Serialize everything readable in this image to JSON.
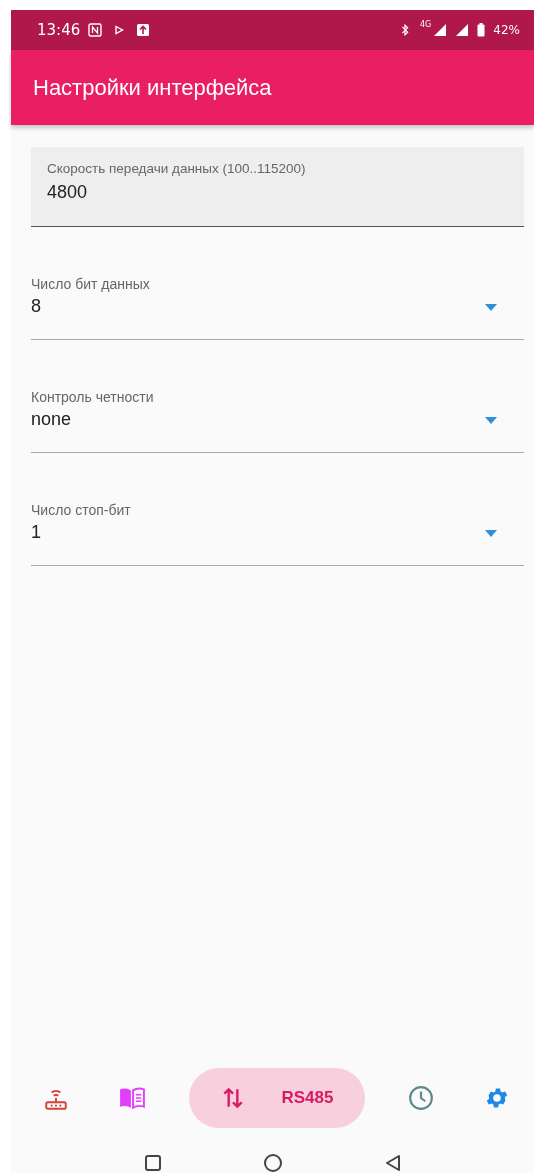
{
  "status_bar": {
    "time": "13:46",
    "network": "4G",
    "battery": "42%"
  },
  "app_bar": {
    "title": "Настройки интерфейса"
  },
  "speed_field": {
    "label": "Скорость передачи данных (100..115200)",
    "value": "4800"
  },
  "dropdowns": [
    {
      "label": "Число бит данных",
      "value": "8"
    },
    {
      "label": "Контроль четности",
      "value": "none"
    },
    {
      "label": "Число стоп-бит",
      "value": "1"
    }
  ],
  "bottom_nav": [
    {
      "selected": false
    },
    {
      "selected": false
    },
    {
      "selected": true,
      "label": "RS485"
    },
    {
      "selected": false
    },
    {
      "selected": false
    }
  ]
}
